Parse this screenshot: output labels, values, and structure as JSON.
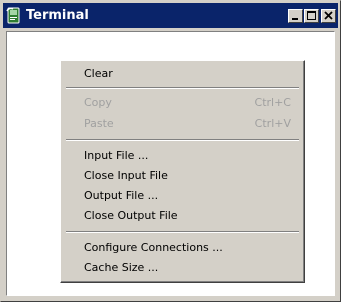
{
  "window": {
    "title": "Terminal",
    "icon": "terminal-app-icon",
    "buttons": [
      "minimize",
      "maximize",
      "close"
    ]
  },
  "menu": {
    "items": [
      {
        "label": "Clear",
        "shortcut": "",
        "enabled": true
      },
      {
        "label": "Copy",
        "shortcut": "Ctrl+C",
        "enabled": false
      },
      {
        "label": "Paste",
        "shortcut": "Ctrl+V",
        "enabled": false
      },
      {
        "label": "Input File ...",
        "shortcut": "",
        "enabled": true
      },
      {
        "label": "Close Input File",
        "shortcut": "",
        "enabled": true
      },
      {
        "label": "Output File ...",
        "shortcut": "",
        "enabled": true
      },
      {
        "label": "Close Output File",
        "shortcut": "",
        "enabled": true
      },
      {
        "label": "Configure Connections ...",
        "shortcut": "",
        "enabled": true
      },
      {
        "label": "Cache Size ...",
        "shortcut": "",
        "enabled": true
      }
    ]
  },
  "colors": {
    "titlebar": "#0a246a",
    "face": "#d4d0c8",
    "disabled_text": "#a0a0a0"
  }
}
